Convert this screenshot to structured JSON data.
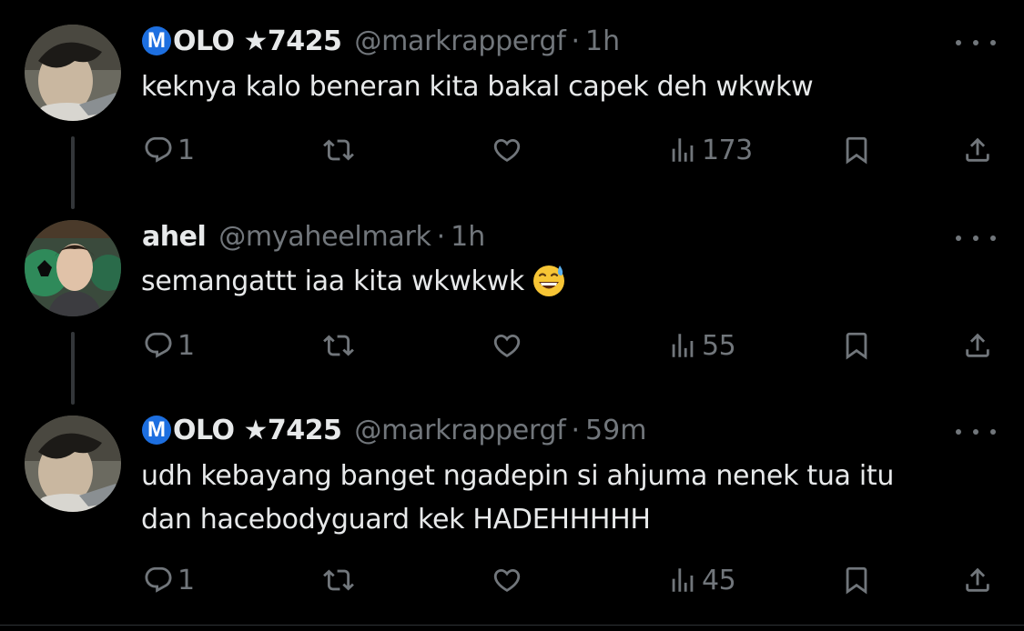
{
  "tweets": [
    {
      "badge": "M",
      "display_name": "OLO ★7425",
      "handle": "@markrappergf",
      "dot": "·",
      "time": "1h",
      "text_lines": [
        "keknya kalo beneran kita bakal capek deh wkwkw"
      ],
      "replies": "1",
      "views": "173"
    },
    {
      "display_name": "ahel",
      "handle": "@myaheelmark",
      "dot": "·",
      "time": "1h",
      "text_lines": [
        "semangattt iaa kita wkwkwk"
      ],
      "emoji": "grinning-sweat-emoji",
      "replies": "1",
      "views": "55"
    },
    {
      "badge": "M",
      "display_name": "OLO ★7425",
      "handle": "@markrappergf",
      "dot": "·",
      "time": "59m",
      "text_lines": [
        "udh kebayang banget ngadepin si ahjuma nenek tua itu",
        "dan hacebodyguard kek HADEHHHHH"
      ],
      "replies": "1",
      "views": "45"
    }
  ],
  "icons": {
    "reply": "reply-icon",
    "retweet": "retweet-icon",
    "like": "like-icon",
    "views": "views-icon",
    "bookmark": "bookmark-icon",
    "share": "share-icon",
    "more": "more-icon"
  },
  "colors": {
    "background": "#000000",
    "text": "#e7e9ea",
    "secondary": "#71767b",
    "badge": "#1d6fe0",
    "thread_line": "#333639"
  }
}
